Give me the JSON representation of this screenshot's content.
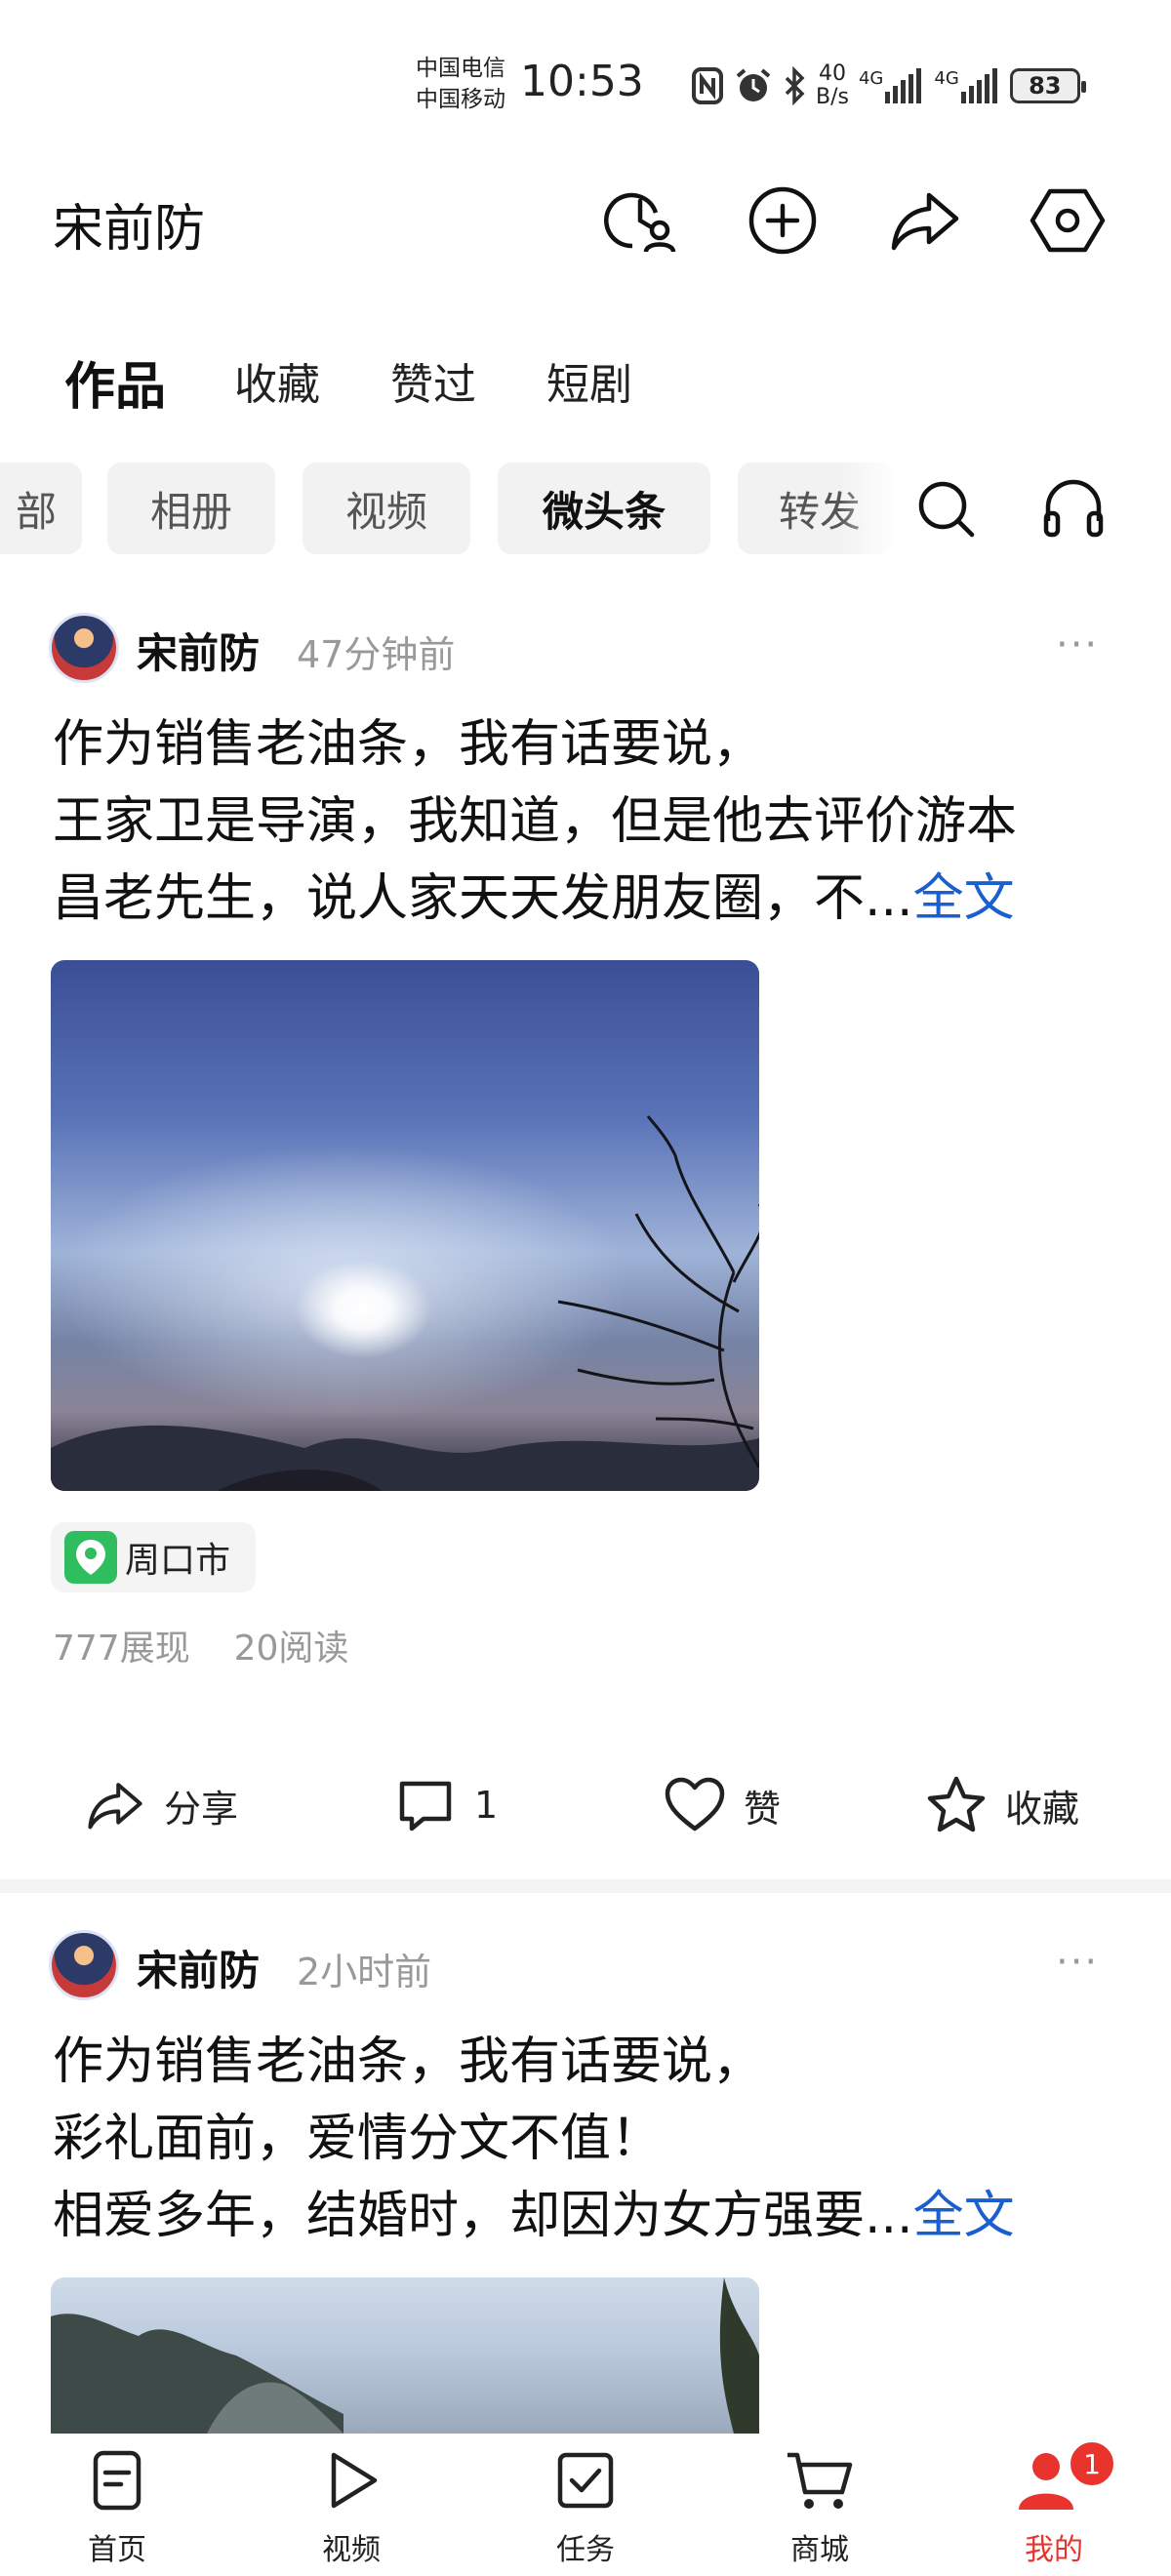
{
  "status_bar": {
    "carrier1": "中国电信",
    "carrier2": "中国移动",
    "time": "10:53",
    "speed_top": "40",
    "speed_bottom": "B/s",
    "net1": "4G",
    "net2": "4G",
    "battery": "83"
  },
  "header": {
    "title": "宋前防",
    "icons": [
      "history-user-icon",
      "add-icon",
      "share-icon",
      "settings-icon"
    ]
  },
  "tabs": [
    "作品",
    "收藏",
    "赞过",
    "短剧"
  ],
  "chips": [
    "部",
    "相册",
    "视频",
    "微头条",
    "转发"
  ],
  "posts": [
    {
      "author": "宋前防",
      "time": "47分钟前",
      "more": "···",
      "lines": [
        "作为销售老油条，我有话要说，",
        "王家卫是导演，我知道，但是他去评价游本",
        "昌老先生，说人家天天发朋友圈，不..."
      ],
      "full_text": "全文",
      "location": "周口市",
      "views": "777展现",
      "reads": "20阅读",
      "actions": {
        "share": "分享",
        "comment": "1",
        "like": "赞",
        "favorite": "收藏"
      }
    },
    {
      "author": "宋前防",
      "time": "2小时前",
      "more": "···",
      "lines": [
        "作为销售老油条，我有话要说，",
        "彩礼面前，爱情分文不值！",
        "相爱多年，结婚时，却因为女方强要..."
      ],
      "full_text": "全文"
    }
  ],
  "bottom_nav": [
    {
      "label": "首页",
      "icon": "home-icon"
    },
    {
      "label": "视频",
      "icon": "play-icon"
    },
    {
      "label": "任务",
      "icon": "task-icon"
    },
    {
      "label": "商城",
      "icon": "cart-icon"
    },
    {
      "label": "我的",
      "icon": "profile-icon",
      "badge": "1"
    }
  ],
  "colors": {
    "accent": "#1a5fd0",
    "active_nav": "#e8342d",
    "location_icon": "#2fbd5f"
  }
}
